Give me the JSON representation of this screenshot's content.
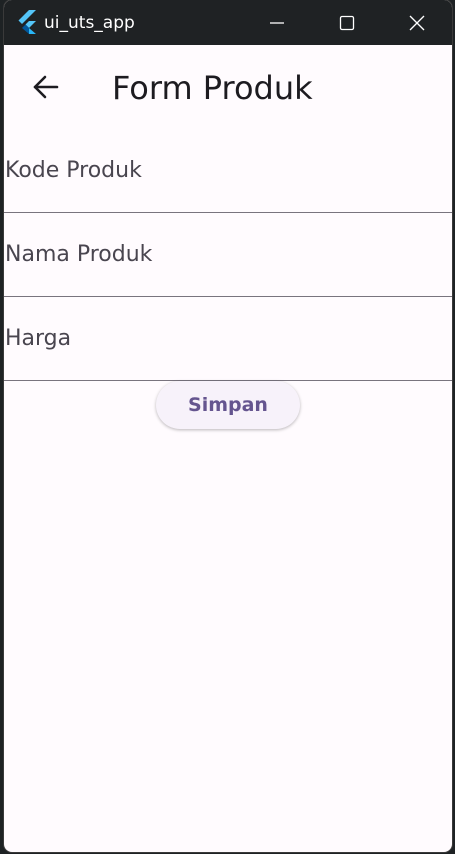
{
  "window": {
    "title": "ui_uts_app",
    "icon": "flutter-logo-icon"
  },
  "appbar": {
    "title": "Form Produk",
    "back_icon": "arrow-left-icon"
  },
  "form": {
    "fields": [
      {
        "placeholder": "Kode Produk",
        "value": ""
      },
      {
        "placeholder": "Nama Produk",
        "value": ""
      },
      {
        "placeholder": "Harga",
        "value": ""
      }
    ],
    "submit_label": "Simpan"
  },
  "colors": {
    "background": "#fffbfe",
    "titlebar": "#1f2224",
    "button_text": "#65558f",
    "divider": "#79747e",
    "flutter_light": "#54c5f8",
    "flutter_dark": "#01579b"
  }
}
